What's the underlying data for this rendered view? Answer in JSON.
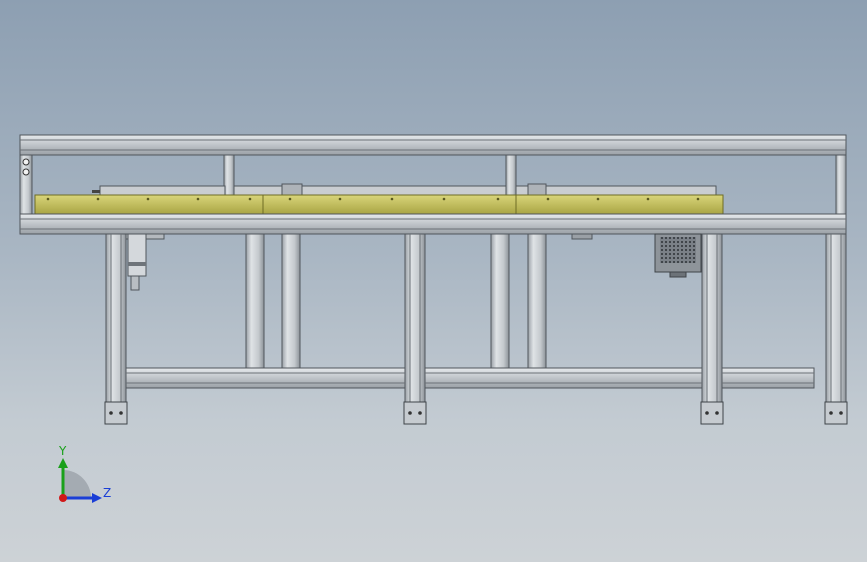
{
  "view": {
    "triad": {
      "y_label": "Y",
      "z_label": "Z",
      "y_color": "#1aa01a",
      "z_color": "#1a3ed6",
      "x_color": "#d01818"
    }
  },
  "colors": {
    "background_top": "#8d9fb2",
    "background_bottom": "#cdd2d6",
    "profile": "#cfd4d8",
    "profile_dark": "#5f666c",
    "plate": "#c8c462",
    "plate_dark": "#7c7a2a"
  }
}
